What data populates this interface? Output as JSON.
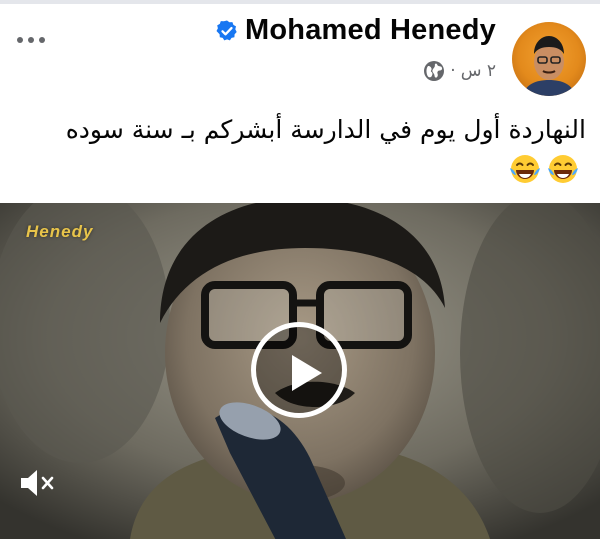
{
  "post": {
    "author_name": "Mohamed Henedy",
    "verified": true,
    "time": "٢ س",
    "separator": "·",
    "audience_icon": "globe-icon",
    "text": "النهاردة أول يوم في الدارسة أبشركم بـ سنة سوده",
    "emojis": [
      "face-with-tears-of-joy",
      "face-with-tears-of-joy"
    ]
  },
  "video": {
    "watermark": "Henedy",
    "play_icon": "play-icon",
    "mute_icon": "speaker-muted-icon"
  },
  "header": {
    "more_icon": "more-options-icon"
  },
  "colors": {
    "verified_blue": "#1877f2",
    "secondary_text": "#65676b",
    "primary_text": "#050505"
  }
}
